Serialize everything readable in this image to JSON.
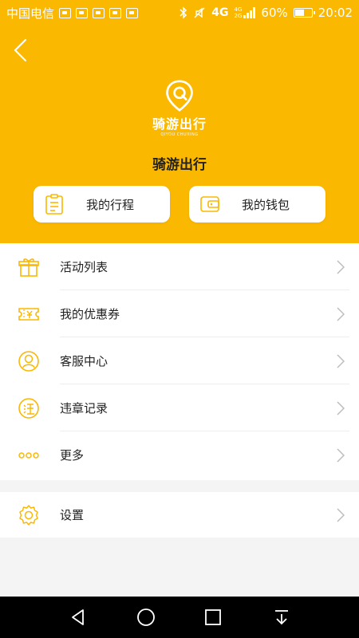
{
  "status_bar": {
    "carrier": "中国电信",
    "network": "4G",
    "network_small_top": "4G",
    "network_small_bottom": "2G",
    "battery": "60%",
    "battery_level": 0.6,
    "time": "20:02"
  },
  "header": {
    "logo_title": "骑游出行",
    "logo_subtitle": "QIYOU CHUXING",
    "app_name": "骑游出行",
    "trip_label": "我的行程",
    "wallet_label": "我的钱包"
  },
  "menu": {
    "items": [
      {
        "label": "活动列表",
        "icon": "gift-icon"
      },
      {
        "label": "我的优惠券",
        "icon": "coupon-icon"
      },
      {
        "label": "客服中心",
        "icon": "customer-service-icon"
      },
      {
        "label": "违章记录",
        "icon": "violation-icon"
      },
      {
        "label": "更多",
        "icon": "more-icon"
      }
    ],
    "settings_label": "设置"
  },
  "colors": {
    "brand": "#fbb800",
    "background": "#f4f4f4",
    "nav_bar": "#000000"
  }
}
